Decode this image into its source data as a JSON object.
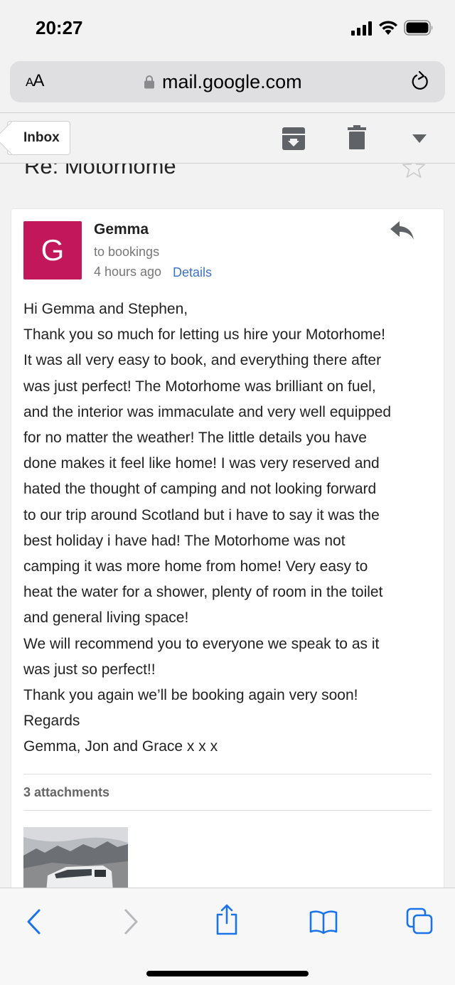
{
  "status_bar": {
    "time": "20:27"
  },
  "browser": {
    "text_size_label": "AA",
    "url": "mail.google.com"
  },
  "toolbar": {
    "back_label": "Inbox"
  },
  "message": {
    "subject": "Re: Motorhome",
    "sender_initial": "G",
    "sender_name": "Gemma",
    "recipient": "to bookings",
    "time": "4 hours ago",
    "details_label": "Details",
    "body_lines": [
      "Hi Gemma and Stephen,",
      "Thank you so much for letting us hire your Motorhome!",
      "It was all very easy to book, and everything there after",
      "was just perfect!  The Motorhome was brilliant on fuel,",
      "and the interior was immaculate and very well equipped",
      "for no matter the weather!  The little details you have",
      "done makes it feel like home! I was very reserved and",
      "hated the thought of camping and not looking forward",
      "to our trip around Scotland but i have to say it was the",
      "best holiday i have had!  The Motorhome was not",
      "camping it was more home from home! Very easy to",
      "heat the water for a shower, plenty of room in the toilet",
      "and general living space!",
      "We will recommend you to everyone we speak to as it",
      "was just so perfect!!",
      "Thank you again we’ll be booking again very soon!",
      "Regards",
      "Gemma, Jon and Grace x x x"
    ],
    "attachments_label": "3 attachments"
  },
  "colors": {
    "avatar": "#c2185b",
    "link": "#3b73c7",
    "safari_tint": "#1a73e8"
  },
  "icons": {
    "toolbar": [
      "archive-icon",
      "trash-icon",
      "more-icon"
    ],
    "bottom": [
      "nav-back-icon",
      "nav-forward-icon",
      "share-icon",
      "bookmarks-icon",
      "tabs-icon"
    ]
  }
}
